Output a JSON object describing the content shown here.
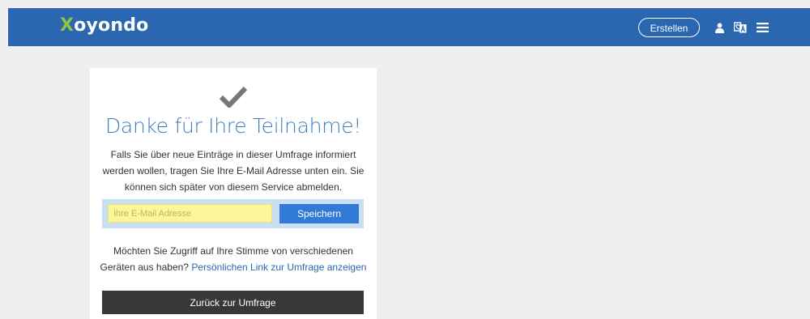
{
  "header": {
    "logo_x": "X",
    "logo_rest": "oyondo",
    "create_label": "Erstellen",
    "icons": [
      "user-icon",
      "language-icon",
      "menu-icon"
    ]
  },
  "card": {
    "check_icon": "checkmark-icon",
    "title": "Danke für Ihre Teilnahme!",
    "description": "Falls Sie über neue Einträge in dieser Umfrage informiert werden wollen, tragen Sie Ihre E-Mail Adresse unten ein. Sie können sich später von diesem Service abmelden.",
    "email_placeholder": "Ihre E-Mail Adresse",
    "email_value": "",
    "save_label": "Speichern",
    "access_text": "Möchten Sie Zugriff auf Ihre Stimme von verschiedenen Geräten aus haben?",
    "access_link": "Persönlichen Link zur Umfrage anzeigen",
    "back_label": "Zurück zur Umfrage"
  },
  "colors": {
    "header_bg": "#2b66b0",
    "logo_accent": "#8dc63f",
    "title": "#3e7dbd",
    "save_button": "#2f7bd6",
    "back_button": "#383838",
    "email_field_bg": "#fbf69b",
    "email_box_bg": "#c9dff3",
    "page_bg": "#efefef"
  }
}
